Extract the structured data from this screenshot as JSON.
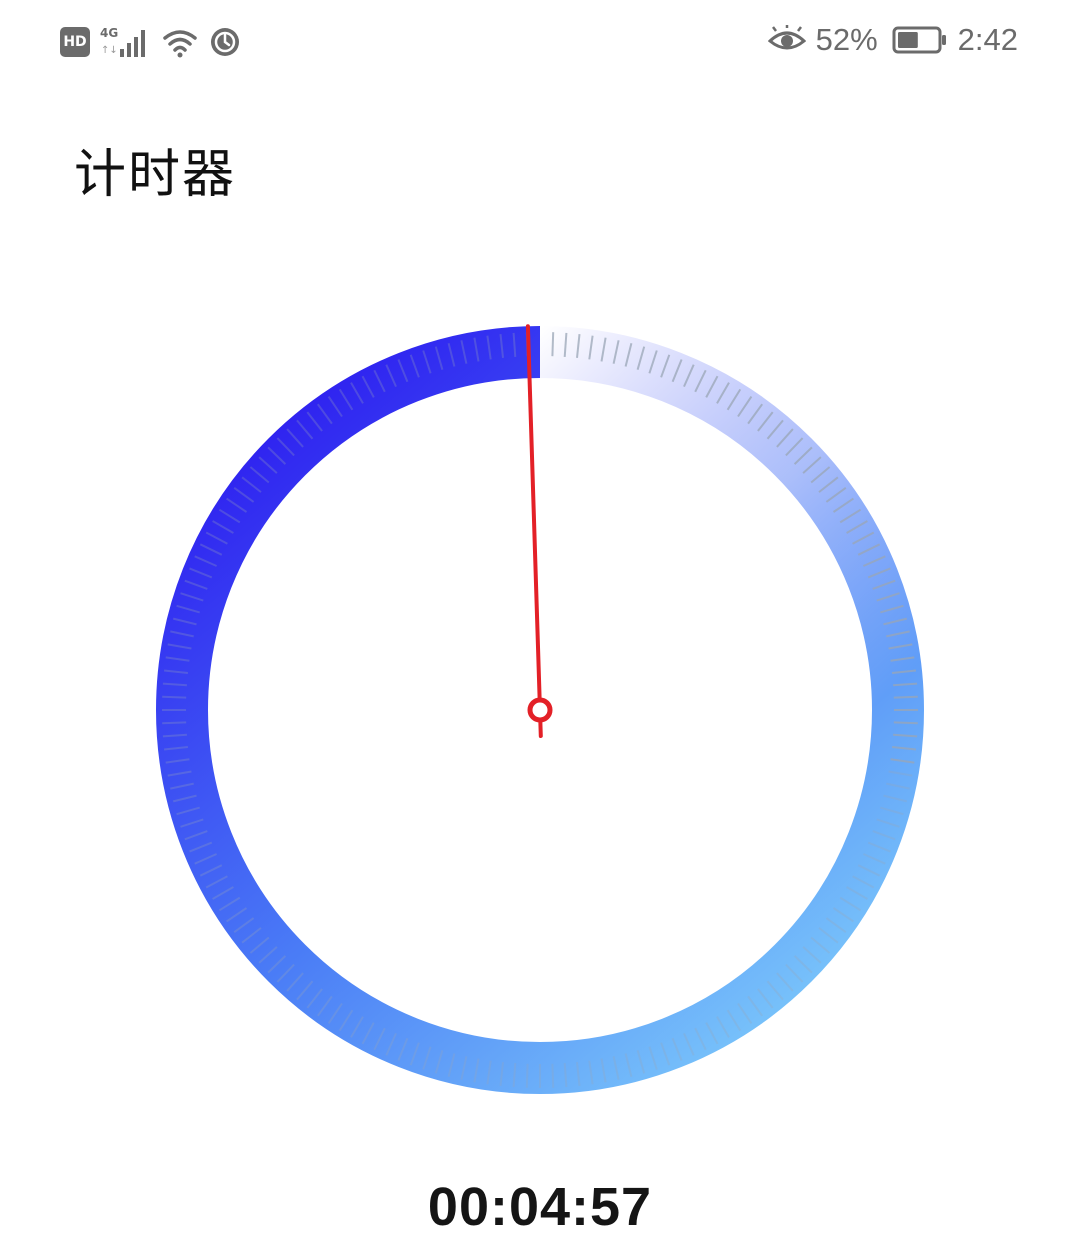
{
  "status_bar": {
    "left_icons": [
      "hd-icon",
      "4g-signal-icon",
      "wifi-icon",
      "timer-status-icon"
    ],
    "hd_label": "HD",
    "network_label": "4G",
    "eye_comfort_icon": "eye-icon",
    "battery_percent": "52%",
    "battery_level": 0.52,
    "time": "2:42"
  },
  "header": {
    "title": "计时器"
  },
  "timer": {
    "elapsed": "00:04:57",
    "progress_fraction": 0.995,
    "colors": {
      "ring_start": "#2e1ff0",
      "ring_mid": "#4a7cf6",
      "ring_end": "#82d2fb",
      "hand": "#e32027",
      "tick": "#9aa6b6"
    }
  }
}
